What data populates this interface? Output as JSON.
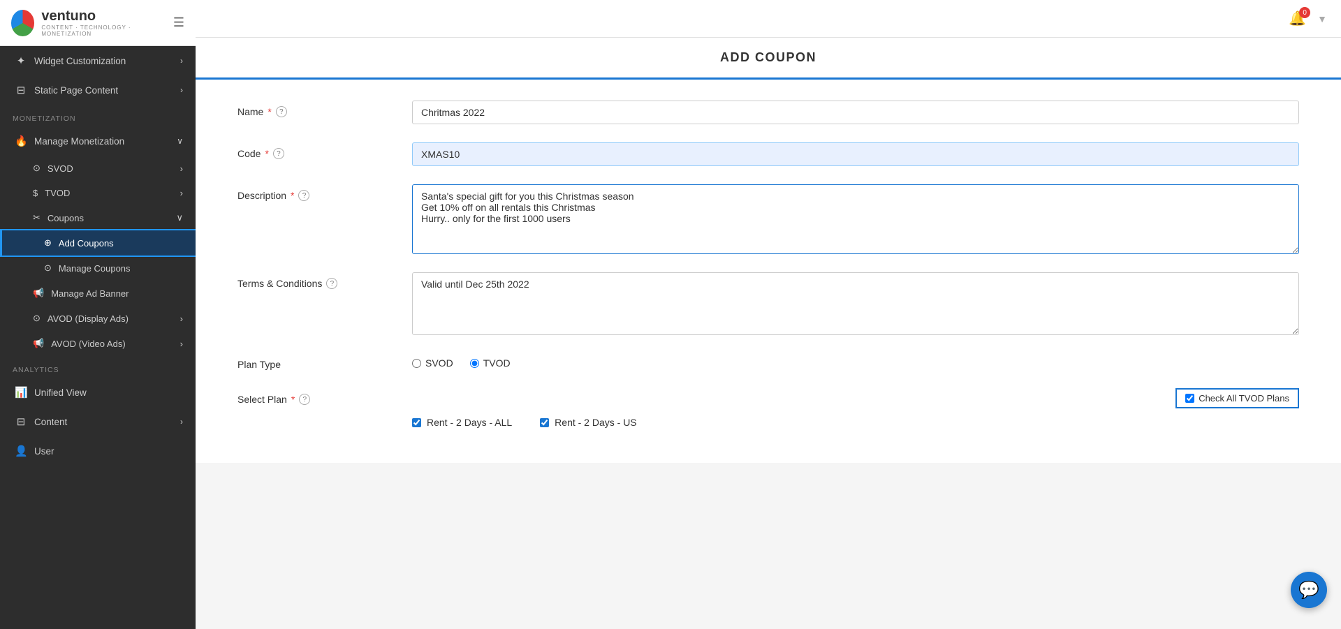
{
  "logo": {
    "name": "ventuno",
    "subtitle": "CONTENT · TECHNOLOGY · MONETIZATION"
  },
  "header": {
    "title": "ADD COUPON",
    "notification_count": "0"
  },
  "sidebar": {
    "items": [
      {
        "id": "widget-customization",
        "label": "Widget Customization",
        "icon": "◫",
        "chevron": "›"
      },
      {
        "id": "static-page-content",
        "label": "Static Page Content",
        "icon": "▦",
        "chevron": "›"
      }
    ],
    "section_monetization": "MONETIZATION",
    "manage_monetization": "Manage Monetization",
    "svod": "SVOD",
    "tvod": "TVOD",
    "coupons": "Coupons",
    "add_coupons": "Add Coupons",
    "manage_coupons": "Manage Coupons",
    "manage_ad_banner": "Manage Ad Banner",
    "avod_display": "AVOD (Display Ads)",
    "avod_video": "AVOD (Video Ads)",
    "section_analytics": "ANALYTICS",
    "unified_view": "Unified View",
    "content": "Content",
    "user": "User"
  },
  "form": {
    "title": "ADD COUPON",
    "name_label": "Name",
    "name_value": "Chritmas 2022",
    "name_placeholder": "",
    "code_label": "Code",
    "code_value": "XMAS10",
    "description_label": "Description",
    "description_value": "Santa's special gift for you this Christmas season\nGet 10% off on all rentals this Christmas\nHurry.. only for the first 1000 users",
    "terms_label": "Terms & Conditions",
    "terms_value": "Valid until Dec 25th 2022",
    "plan_type_label": "Plan Type",
    "plan_type_svod": "SVOD",
    "plan_type_tvod": "TVOD",
    "select_plan_label": "Select Plan",
    "check_all_label": "Check All TVOD Plans",
    "plan_option_1": "Rent - 2 Days - ALL",
    "plan_option_2": "Rent - 2 Days - US"
  }
}
